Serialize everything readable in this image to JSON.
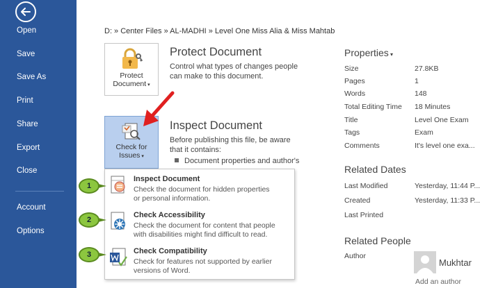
{
  "sidebar": {
    "items": [
      {
        "label": "Open"
      },
      {
        "label": "Save"
      },
      {
        "label": "Save As"
      },
      {
        "label": "Print"
      },
      {
        "label": "Share"
      },
      {
        "label": "Export"
      },
      {
        "label": "Close"
      },
      {
        "label": "Account"
      },
      {
        "label": "Options"
      }
    ]
  },
  "breadcrumb": "D: » Center Files » AL-MADHI » Level One Miss Alia & Miss Mahtab",
  "protect": {
    "button_line1": "Protect",
    "button_line2": "Document",
    "title": "Protect Document",
    "desc_line1": "Control what types of changes people",
    "desc_line2": "can make to this document."
  },
  "inspect": {
    "button_line1": "Check for",
    "button_line2": "Issues",
    "title": "Inspect Document",
    "desc_line1": "Before publishing this file, be aware",
    "desc_line2": "that it contains:",
    "bullet1": "Document properties and author's"
  },
  "dropdown": {
    "items": [
      {
        "title": "Inspect Document",
        "desc1": "Check the document for hidden properties",
        "desc2": "or personal information."
      },
      {
        "title": "Check Accessibility",
        "desc1": "Check the document for content that people",
        "desc2": "with disabilities might find difficult to read."
      },
      {
        "title": "Check Compatibility",
        "desc1": "Check for features not supported by earlier",
        "desc2": "versions of Word."
      }
    ]
  },
  "markers": [
    "1",
    "2",
    "3"
  ],
  "properties": {
    "heading": "Properties",
    "rows": [
      {
        "label": "Size",
        "value": "27.8KB"
      },
      {
        "label": "Pages",
        "value": "1"
      },
      {
        "label": "Words",
        "value": "148"
      },
      {
        "label": "Total Editing Time",
        "value": "18 Minutes"
      },
      {
        "label": "Title",
        "value": "Level One Exam"
      },
      {
        "label": "Tags",
        "value": "Exam"
      },
      {
        "label": "Comments",
        "value": "It's level one exa..."
      }
    ]
  },
  "related_dates": {
    "heading": "Related Dates",
    "rows": [
      {
        "label": "Last Modified",
        "value": "Yesterday, 11:44 P..."
      },
      {
        "label": "Created",
        "value": "Yesterday, 11:33 P..."
      },
      {
        "label": "Last Printed",
        "value": ""
      }
    ]
  },
  "related_people": {
    "heading": "Related People",
    "author_label": "Author",
    "author_name": "Mukhtar",
    "add_author": "Add an author"
  },
  "colors": {
    "sidebar": "#2b579a",
    "active_button": "#b9cfee",
    "marker_fill": "#8cc63f",
    "arrow": "#e02020"
  }
}
